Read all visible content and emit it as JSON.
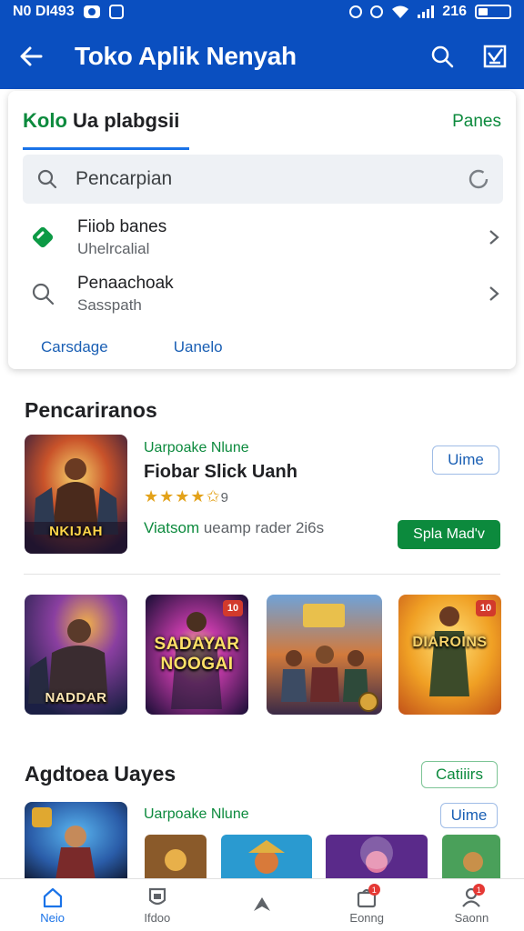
{
  "status_bar": {
    "left_text": "N0 DI493",
    "time": "216"
  },
  "app_bar": {
    "title": "Toko Aplik Nenyah"
  },
  "search_card": {
    "title_green": "Kolo",
    "title_rest": " Ua plabgsii",
    "link": "Panes",
    "search_placeholder": "Pencarpian",
    "rows": [
      {
        "title": "Fiiob banes",
        "subtitle": "Uhelrcalial",
        "icon": "tag-icon"
      },
      {
        "title": "Penaachoak",
        "subtitle": "Sasspath",
        "icon": "search-icon"
      }
    ],
    "tabs": [
      "Carsdage",
      "Uanelo"
    ]
  },
  "section1": {
    "title": "Pencariranos",
    "featured": {
      "developer": "Uarpoake Nlune",
      "name": "Fiobar Slick Uanh",
      "stars": "★★★★✩",
      "rating_suffix": "9",
      "meta_green": "Viatsom",
      "meta_rest": " ueamp rader 2i6s",
      "outline_button": "Uime",
      "install_button": "Spla Mad'v",
      "thumb_text": "NKIJAH"
    },
    "tiles": [
      {
        "label": "NADDAR",
        "badge": ""
      },
      {
        "label": "SADAYAR NOOGAI",
        "badge": "10"
      },
      {
        "label": "",
        "badge": ""
      },
      {
        "label": "DIAROINS",
        "badge": "10"
      }
    ]
  },
  "section2": {
    "title": "Agdtoea Uayes",
    "outline_button": "Catiiirs",
    "developer": "Uarpoake Nlune",
    "install_button": "Uime"
  },
  "bottom_nav": [
    {
      "label": "Neio",
      "icon": "home-icon",
      "active": true
    },
    {
      "label": "Ifdoo",
      "icon": "games-icon",
      "active": false
    },
    {
      "label": "",
      "icon": "apps-icon",
      "active": false
    },
    {
      "label": "Eonng",
      "icon": "bag-icon",
      "active": false,
      "badge": "1"
    },
    {
      "label": "Saonn",
      "icon": "account-icon",
      "active": false,
      "badge": "1"
    }
  ]
}
